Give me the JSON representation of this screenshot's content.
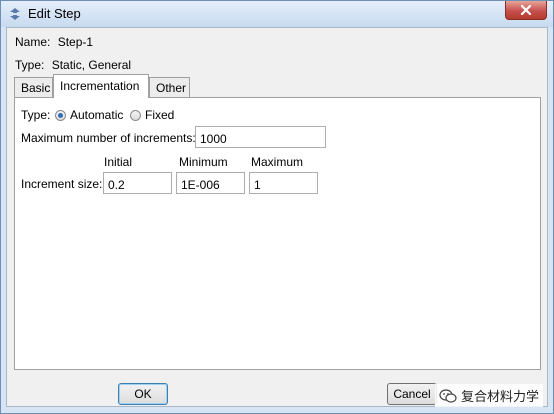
{
  "window": {
    "title": "Edit Step",
    "app_icon": "step-icon",
    "close_icon": "close-icon"
  },
  "info": {
    "name_label": "Name:",
    "name_value": "Step-1",
    "type_label": "Type:",
    "type_value": "Static, General"
  },
  "tabs": [
    {
      "label": "Basic",
      "active": false
    },
    {
      "label": "Incrementation",
      "active": true
    },
    {
      "label": "Other",
      "active": false
    }
  ],
  "incrementation": {
    "type_label": "Type:",
    "options": [
      {
        "label": "Automatic",
        "selected": true
      },
      {
        "label": "Fixed",
        "selected": false
      }
    ],
    "max_increments_label": "Maximum number of increments:",
    "max_increments_value": "1000",
    "columns": [
      "Initial",
      "Minimum",
      "Maximum"
    ],
    "increment_size_label": "Increment size:",
    "increment_size_values": [
      "0.2",
      "1E-006",
      "1"
    ]
  },
  "buttons": {
    "ok": "OK",
    "cancel": "Cancel"
  },
  "watermark": {
    "text": "复合材料力学",
    "icon": "wechat-icon"
  },
  "colors": {
    "frame": "#d6e4f4",
    "close_button": "#c75050",
    "radio_dot": "#2f6fb8"
  }
}
